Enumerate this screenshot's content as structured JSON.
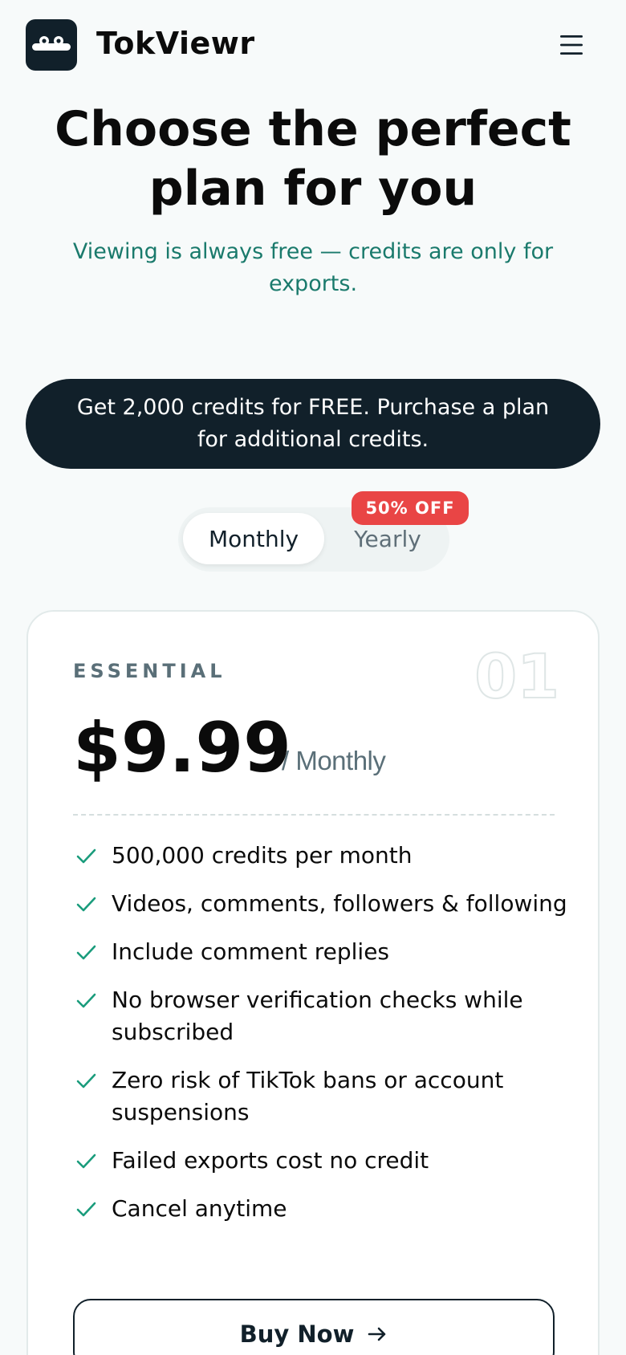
{
  "header": {
    "brand": "TokViewr",
    "logo_icon": "robot-face-icon",
    "menu_icon": "hamburger-menu-icon"
  },
  "hero": {
    "title": "Choose the perfect plan for you",
    "subtitle": "Viewing is always free — credits are only for exports."
  },
  "banner": {
    "text": "Get 2,000 credits for FREE. Purchase a plan for additional credits."
  },
  "billing_toggle": {
    "monthly_label": "Monthly",
    "yearly_label": "Yearly",
    "selected": "Monthly",
    "discount_badge": "50% OFF"
  },
  "plan": {
    "tier": "ESSENTIAL",
    "number": "01",
    "price": "$9.99",
    "period": "/ Monthly",
    "features": [
      "500,000 credits per month",
      "Videos, comments, followers & following",
      "Include comment replies",
      "No browser verification checks while subscribed",
      "Zero risk of TikTok bans or account suspensions",
      "Failed exports cost no credit",
      "Cancel anytime"
    ],
    "check_icon": "check-icon",
    "buy_label": "Buy Now",
    "buy_icon": "arrow-right-icon"
  },
  "colors": {
    "page_bg": "#f7fafa",
    "dark": "#11202a",
    "accent_teal": "#1a7a6c",
    "check_green": "#1a9c7c",
    "badge_red": "#e94545",
    "muted": "#5a6f78"
  }
}
